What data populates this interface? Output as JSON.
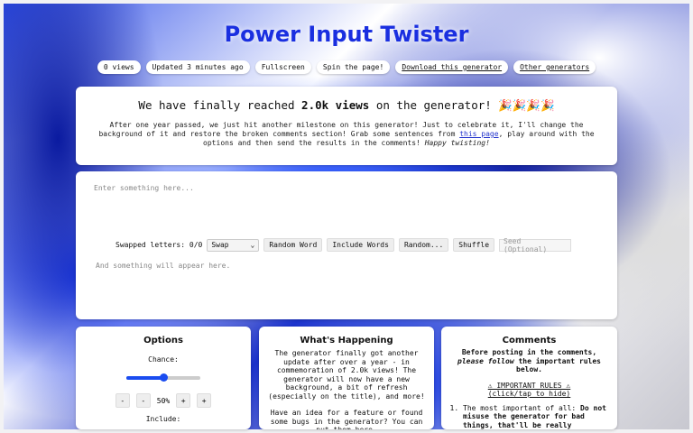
{
  "header": {
    "title": "Power Input Twister"
  },
  "pills": [
    {
      "label": "0 views",
      "link": false
    },
    {
      "label": "Updated 3 minutes ago",
      "link": false
    },
    {
      "label": "Fullscreen",
      "link": false
    },
    {
      "label": "Spin the page!",
      "link": false
    },
    {
      "label": "Download this generator",
      "link": true
    },
    {
      "label": "Other generators",
      "link": true
    }
  ],
  "announcement": {
    "heading_pre": "We have finally reached ",
    "heading_bold": "2.0k views",
    "heading_post": " on the generator! 🎉🎉🎉🎉",
    "body_1": "After one year passed, we just hit another milestone on this generator! Just to celebrate it, I'll change the background of it and restore the broken comments section! Grab some sentences from ",
    "body_link": "this page",
    "body_2": ", play around with the options and then send the results in the comments! ",
    "body_italic": "Happy twisting!"
  },
  "generator": {
    "input_placeholder": "Enter something here...",
    "swapped_label": "Swapped letters: 0/0",
    "mode_select": "Swap",
    "btn_random_word": "Random Word",
    "btn_include_words": "Include Words",
    "btn_random": "Random...",
    "btn_shuffle": "Shuffle",
    "seed_placeholder": "Seed (Optional)",
    "output_placeholder": "And something will appear here."
  },
  "options": {
    "title": "Options",
    "chance_label": "Chance:",
    "chance_value": 50,
    "chance_display": "50%",
    "minus2": "-",
    "minus1": "-",
    "plus1": "+",
    "plus2": "+",
    "include_label": "Include:"
  },
  "happening": {
    "title": "What's Happening",
    "p1": "The generator finally got another update after over a year - in commemoration of 2.0k views! The generator will now have a new background, a bit of refresh (especially on the title), and more!",
    "p2": "Have an idea for a feature or found some bugs in the generator? You can put them here."
  },
  "comments": {
    "title": "Comments",
    "intro_1": "Before posting in the comments, ",
    "intro_italic": "please follow",
    "intro_2": " the important rules below.",
    "rules_title": "⚠ IMPORTANT RULES ⚠",
    "rules_toggle": "(click/tap to hide)",
    "rule1_pre": "The most important of all: ",
    "rule1_bold": "Do not misuse the generator for bad things, that'll be really"
  },
  "icons": {
    "select_chevron": "chevron-down-icon",
    "warning": "warning-icon"
  },
  "colors": {
    "title": "#1a2fe0",
    "accent": "#1a4cf0",
    "link": "#2233cc"
  }
}
